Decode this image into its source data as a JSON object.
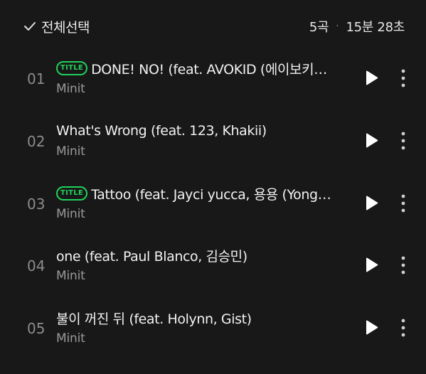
{
  "header": {
    "select_all_label": "전체선택",
    "song_count": "5곡",
    "separator": "·",
    "total_duration": "15분 28초"
  },
  "badge_label": "TITLE",
  "tracks": [
    {
      "number": "01",
      "title": "DONE! NO! (feat. AVOKID (에이보키…",
      "artist": "Minit",
      "is_title": true
    },
    {
      "number": "02",
      "title": "What's Wrong (feat. 123, Khakii)",
      "artist": "Minit",
      "is_title": false
    },
    {
      "number": "03",
      "title": "Tattoo (feat. Jayci yucca, 용용 (Yong…",
      "artist": "Minit",
      "is_title": true
    },
    {
      "number": "04",
      "title": "one (feat. Paul Blanco, 김승민)",
      "artist": "Minit",
      "is_title": false
    },
    {
      "number": "05",
      "title": "불이 꺼진 뒤 (feat. Holynn, Gist)",
      "artist": "Minit",
      "is_title": false
    }
  ],
  "colors": {
    "background": "#181818",
    "accent_green": "#22d05a",
    "text_primary": "#f2f2f2",
    "text_secondary": "#9a9a9a"
  },
  "icons": {
    "select_all": "check-icon",
    "play": "play-icon",
    "more": "more-vertical-icon"
  }
}
